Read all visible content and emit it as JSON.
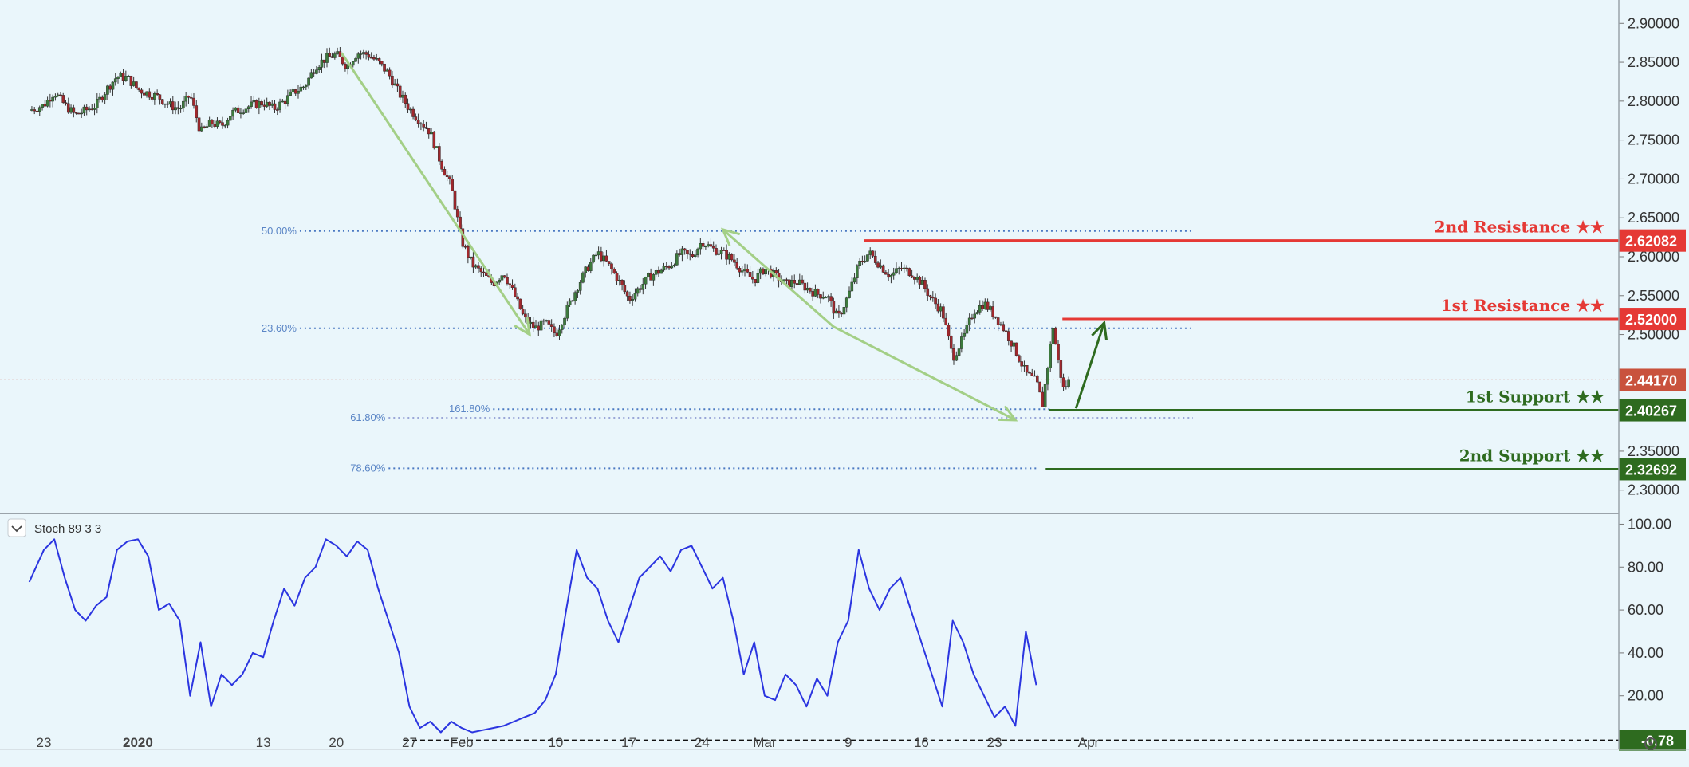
{
  "colors": {
    "background": "#eaf6fb",
    "resistance": "#e53935",
    "support": "#2e6b1f",
    "fib_line": "#4a78c2",
    "fib_line_faint": "#9aa7d8",
    "arrow": "#a3cf86",
    "current_price": "#c9523d",
    "stoch": "#2b35e0",
    "candle_up": "#3d7a3d",
    "candle_down": "#a0282d"
  },
  "icons": {
    "collapse": "chevron-down-icon",
    "settings": "gear-icon"
  },
  "chart_data": [
    {
      "type": "candlestick",
      "ylim": [
        2.27,
        2.93
      ],
      "y_ticks": [
        "2.90000",
        "2.85000",
        "2.80000",
        "2.75000",
        "2.70000",
        "2.65000",
        "2.60000",
        "2.55000",
        "2.50000",
        "2.35000",
        "2.30000"
      ],
      "y_tick_values": [
        2.9,
        2.85,
        2.8,
        2.75,
        2.7,
        2.65,
        2.6,
        2.55,
        2.5,
        2.35,
        2.3
      ],
      "x_ticks": [
        "23",
        "2020",
        "13",
        "20",
        "27",
        "Feb",
        "10",
        "17",
        "24",
        "Mar",
        "9",
        "16",
        "23",
        "Apr"
      ],
      "x_tick_days": [
        0,
        9,
        21,
        28,
        35,
        40,
        49,
        56,
        63,
        69,
        77,
        84,
        91,
        100
      ],
      "price_path": [
        [
          -1.4,
          2.788
        ],
        [
          0,
          2.795
        ],
        [
          1,
          2.812
        ],
        [
          2,
          2.795
        ],
        [
          3,
          2.782
        ],
        [
          4,
          2.788
        ],
        [
          5,
          2.795
        ],
        [
          6,
          2.815
        ],
        [
          7,
          2.832
        ],
        [
          8,
          2.83
        ],
        [
          9,
          2.815
        ],
        [
          10,
          2.81
        ],
        [
          11,
          2.805
        ],
        [
          12,
          2.795
        ],
        [
          13,
          2.79
        ],
        [
          14,
          2.808
        ],
        [
          15,
          2.76
        ],
        [
          16,
          2.772
        ],
        [
          17,
          2.768
        ],
        [
          18,
          2.785
        ],
        [
          19,
          2.79
        ],
        [
          20,
          2.795
        ],
        [
          21,
          2.798
        ],
        [
          22,
          2.79
        ],
        [
          23,
          2.8
        ],
        [
          24,
          2.812
        ],
        [
          25,
          2.82
        ],
        [
          26,
          2.845
        ],
        [
          27,
          2.855
        ],
        [
          28,
          2.86
        ],
        [
          29,
          2.845
        ],
        [
          30,
          2.862
        ],
        [
          31,
          2.86
        ],
        [
          32,
          2.85
        ],
        [
          33,
          2.835
        ],
        [
          34,
          2.81
        ],
        [
          35,
          2.79
        ],
        [
          36,
          2.775
        ],
        [
          37,
          2.76
        ],
        [
          38,
          2.72
        ],
        [
          39,
          2.69
        ],
        [
          40,
          2.62
        ],
        [
          41,
          2.59
        ],
        [
          42,
          2.578
        ],
        [
          43,
          2.565
        ],
        [
          44,
          2.58
        ],
        [
          45,
          2.552
        ],
        [
          46,
          2.52
        ],
        [
          47,
          2.508
        ],
        [
          48,
          2.515
        ],
        [
          49,
          2.5
        ],
        [
          50,
          2.53
        ],
        [
          51,
          2.56
        ],
        [
          52,
          2.585
        ],
        [
          53,
          2.605
        ],
        [
          54,
          2.59
        ],
        [
          55,
          2.57
        ],
        [
          56,
          2.545
        ],
        [
          57,
          2.56
        ],
        [
          58,
          2.575
        ],
        [
          59,
          2.582
        ],
        [
          60,
          2.59
        ],
        [
          61,
          2.605
        ],
        [
          62,
          2.6
        ],
        [
          63,
          2.62
        ],
        [
          64,
          2.61
        ],
        [
          65,
          2.605
        ],
        [
          66,
          2.595
        ],
        [
          67,
          2.58
        ],
        [
          68,
          2.57
        ],
        [
          69,
          2.585
        ],
        [
          70,
          2.575
        ],
        [
          71,
          2.565
        ],
        [
          72,
          2.568
        ],
        [
          73,
          2.56
        ],
        [
          74,
          2.552
        ],
        [
          75,
          2.55
        ],
        [
          76,
          2.52
        ],
        [
          77,
          2.55
        ],
        [
          78,
          2.59
        ],
        [
          79,
          2.605
        ],
        [
          80,
          2.59
        ],
        [
          81,
          2.575
        ],
        [
          82,
          2.585
        ],
        [
          83,
          2.58
        ],
        [
          84,
          2.567
        ],
        [
          85,
          2.545
        ],
        [
          86,
          2.53
        ],
        [
          87,
          2.47
        ],
        [
          88,
          2.495
        ],
        [
          89,
          2.53
        ],
        [
          90,
          2.54
        ],
        [
          91,
          2.525
        ],
        [
          92,
          2.505
        ],
        [
          93,
          2.48
        ],
        [
          94,
          2.45
        ],
        [
          95,
          2.44
        ],
        [
          95.6,
          2.41
        ],
        [
          96.1,
          2.46
        ],
        [
          96.6,
          2.51
        ],
        [
          97.1,
          2.465
        ],
        [
          97.6,
          2.43
        ],
        [
          98.1,
          2.44
        ]
      ],
      "current_price": {
        "value": 2.4417,
        "label": "2.44170"
      },
      "levels": [
        {
          "name": "2nd Resistance ★★",
          "value": 2.62082,
          "label": "2.62082",
          "kind": "resistance",
          "line_start": 78.5
        },
        {
          "name": "1st Resistance ★★",
          "value": 2.52,
          "label": "2.52000",
          "kind": "resistance",
          "line_start": 97.5
        },
        {
          "name": "1st Support ★★",
          "value": 2.40267,
          "label": "2.40267",
          "kind": "support",
          "line_start": 96.2
        },
        {
          "name": "2nd Support ★★",
          "value": 2.32692,
          "label": "2.32692",
          "kind": "support",
          "line_start": 95.9
        }
      ],
      "fib_levels": [
        {
          "label": "50.00%",
          "value": 2.633,
          "start": 24.5,
          "end": 110
        },
        {
          "label": "23.60%",
          "value": 2.508,
          "start": 24.5,
          "end": 110
        },
        {
          "label": "161.80%",
          "value": 2.404,
          "start": 43.0,
          "end": 96.5
        },
        {
          "label": "61.80%",
          "value": 2.393,
          "start": 33.0,
          "end": 110
        },
        {
          "label": "78.60%",
          "value": 2.328,
          "start": 33.0,
          "end": 95.0
        }
      ],
      "arrows": [
        {
          "from": [
            28.5,
            2.862
          ],
          "to": [
            46.5,
            2.5
          ]
        },
        {
          "from": [
            75.6,
            2.51
          ],
          "to": [
            65.0,
            2.635
          ]
        },
        {
          "from": [
            75.6,
            2.51
          ],
          "to": [
            93.0,
            2.39
          ]
        },
        {
          "from": [
            98.8,
            2.405
          ],
          "to": [
            101.5,
            2.515
          ]
        }
      ]
    },
    {
      "type": "line",
      "title": "Stoch 89 3 3",
      "ylim": [
        -5,
        105
      ],
      "y_ticks": [
        "100.00",
        "80.00",
        "60.00",
        "40.00",
        "20.00"
      ],
      "y_tick_values": [
        100,
        80,
        60,
        40,
        20
      ],
      "reference": {
        "value": -0.78,
        "label": "-0.78",
        "line_start": 34.5
      },
      "series": [
        {
          "values": [
            [
              -1.4,
              73
            ],
            [
              0,
              88
            ],
            [
              1,
              93
            ],
            [
              2,
              75
            ],
            [
              3,
              60
            ],
            [
              4,
              55
            ],
            [
              5,
              62
            ],
            [
              6,
              66
            ],
            [
              7,
              88
            ],
            [
              8,
              92
            ],
            [
              9,
              93
            ],
            [
              10,
              85
            ],
            [
              11,
              60
            ],
            [
              12,
              63
            ],
            [
              13,
              55
            ],
            [
              14,
              20
            ],
            [
              15,
              45
            ],
            [
              16,
              15
            ],
            [
              17,
              30
            ],
            [
              18,
              25
            ],
            [
              19,
              30
            ],
            [
              20,
              40
            ],
            [
              21,
              38
            ],
            [
              22,
              55
            ],
            [
              23,
              70
            ],
            [
              24,
              62
            ],
            [
              25,
              75
            ],
            [
              26,
              80
            ],
            [
              27,
              93
            ],
            [
              28,
              90
            ],
            [
              29,
              85
            ],
            [
              30,
              92
            ],
            [
              31,
              88
            ],
            [
              32,
              70
            ],
            [
              33,
              55
            ],
            [
              34,
              40
            ],
            [
              35,
              15
            ],
            [
              36,
              5
            ],
            [
              37,
              8
            ],
            [
              38,
              3
            ],
            [
              39,
              8
            ],
            [
              40,
              5
            ],
            [
              41,
              3
            ],
            [
              42,
              4
            ],
            [
              43,
              5
            ],
            [
              44,
              6
            ],
            [
              45,
              8
            ],
            [
              46,
              10
            ],
            [
              47,
              12
            ],
            [
              48,
              18
            ],
            [
              49,
              30
            ],
            [
              50,
              60
            ],
            [
              51,
              88
            ],
            [
              52,
              75
            ],
            [
              53,
              70
            ],
            [
              54,
              55
            ],
            [
              55,
              45
            ],
            [
              56,
              60
            ],
            [
              57,
              75
            ],
            [
              58,
              80
            ],
            [
              59,
              85
            ],
            [
              60,
              78
            ],
            [
              61,
              88
            ],
            [
              62,
              90
            ],
            [
              63,
              80
            ],
            [
              64,
              70
            ],
            [
              65,
              75
            ],
            [
              66,
              55
            ],
            [
              67,
              30
            ],
            [
              68,
              45
            ],
            [
              69,
              20
            ],
            [
              70,
              18
            ],
            [
              71,
              30
            ],
            [
              72,
              25
            ],
            [
              73,
              15
            ],
            [
              74,
              28
            ],
            [
              75,
              20
            ],
            [
              76,
              45
            ],
            [
              77,
              55
            ],
            [
              78,
              88
            ],
            [
              79,
              70
            ],
            [
              80,
              60
            ],
            [
              81,
              70
            ],
            [
              82,
              75
            ],
            [
              83,
              60
            ],
            [
              84,
              45
            ],
            [
              85,
              30
            ],
            [
              86,
              15
            ],
            [
              87,
              55
            ],
            [
              88,
              45
            ],
            [
              89,
              30
            ],
            [
              90,
              20
            ],
            [
              91,
              10
            ],
            [
              92,
              15
            ],
            [
              93,
              6
            ],
            [
              94,
              50
            ],
            [
              95,
              25
            ]
          ]
        }
      ]
    }
  ]
}
